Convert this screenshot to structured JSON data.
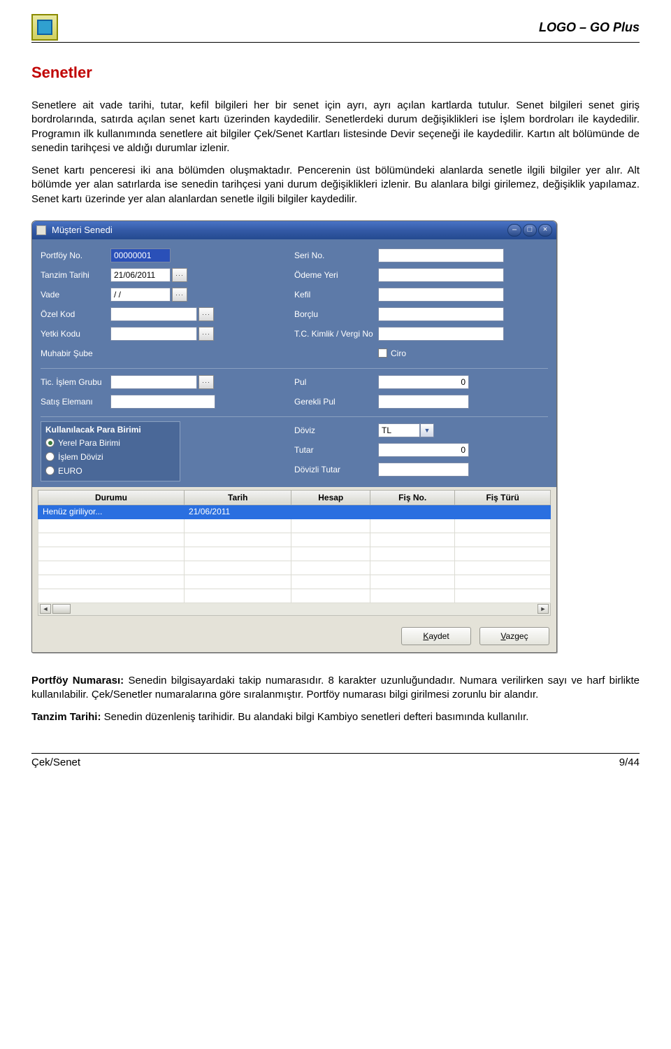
{
  "header": {
    "product": "LOGO – GO Plus"
  },
  "section": {
    "title": "Senetler",
    "p1": "Senetlere ait vade tarihi, tutar, kefil bilgileri her bir senet için ayrı, ayrı açılan kartlarda tutulur. Senet bilgileri senet giriş bordrolarında, satırda açılan senet kartı üzerinden kaydedilir. Senetlerdeki durum değişiklikleri ise İşlem bordroları ile kaydedilir. Programın ilk kullanımında senetlere ait bilgiler Çek/Senet Kartları listesinde Devir seçeneği ile kaydedilir. Kartın alt bölümünde de senedin tarihçesi ve aldığı durumlar izlenir.",
    "p2": "Senet kartı penceresi iki ana bölümden oluşmaktadır. Pencerenin üst bölümündeki alanlarda senetle ilgili bilgiler yer alır. Alt bölümde yer alan satırlarda ise senedin tarihçesi yani durum değişiklikleri izlenir. Bu alanlara bilgi girilemez, değişiklik yapılamaz. Senet kartı üzerinde yer alan alanlardan senetle ilgili bilgiler kaydedilir."
  },
  "dialog": {
    "title": "Müşteri Senedi",
    "left": {
      "portfoy_label": "Portföy No.",
      "portfoy_value": "00000001",
      "tanzim_label": "Tanzim Tarihi",
      "tanzim_value": "21/06/2011",
      "vade_label": "Vade",
      "vade_value": "/ /",
      "ozel_label": "Özel Kod",
      "ozel_value": "",
      "yetki_label": "Yetki Kodu",
      "yetki_value": "",
      "muhabir_label": "Muhabir Şube",
      "tic_label": "Tic. İşlem Grubu",
      "tic_value": "",
      "satis_label": "Satış Elemanı",
      "satis_value": ""
    },
    "right": {
      "seri_label": "Seri No.",
      "seri_value": "",
      "odeme_label": "Ödeme Yeri",
      "odeme_value": "",
      "kefil_label": "Kefil",
      "kefil_value": "",
      "borclu_label": "Borçlu",
      "borclu_value": "",
      "tc_label": "T.C. Kimlik / Vergi No",
      "tc_value": "",
      "ciro_label": "Ciro",
      "pul_label": "Pul",
      "pul_value": "0",
      "gerekli_label": "Gerekli Pul",
      "gerekli_value": "",
      "doviz_label": "Döviz",
      "doviz_value": "TL",
      "tutar_label": "Tutar",
      "tutar_value": "0",
      "dovizli_label": "Dövizli Tutar",
      "dovizli_value": ""
    },
    "currency": {
      "header": "Kullanılacak Para Birimi",
      "opt1": "Yerel Para Birimi",
      "opt2": "İşlem Dövizi",
      "opt3": "EURO"
    },
    "grid": {
      "cols": [
        "Durumu",
        "Tarih",
        "Hesap",
        "Fiş No.",
        "Fiş Türü"
      ],
      "row": {
        "durumu": "Henüz giriliyor...",
        "tarih": "21/06/2011"
      }
    },
    "buttons": {
      "save": "Kaydet",
      "cancel": "Vazgeç"
    }
  },
  "after": {
    "portfoy_head": "Portföy Numarası:",
    "portfoy_body": " Senedin bilgisayardaki takip numarasıdır. 8 karakter uzunluğundadır. Numara verilirken sayı ve harf birlikte kullanılabilir. Çek/Senetler numaralarına göre sıralanmıştır. Portföy numarası bilgi girilmesi zorunlu bir alandır.",
    "tanzim_head": "Tanzim Tarihi:",
    "tanzim_body": " Senedin düzenleniş tarihidir. Bu alandaki bilgi Kambiyo senetleri defteri basımında kullanılır."
  },
  "footer": {
    "left": "Çek/Senet",
    "right": "9/44"
  }
}
